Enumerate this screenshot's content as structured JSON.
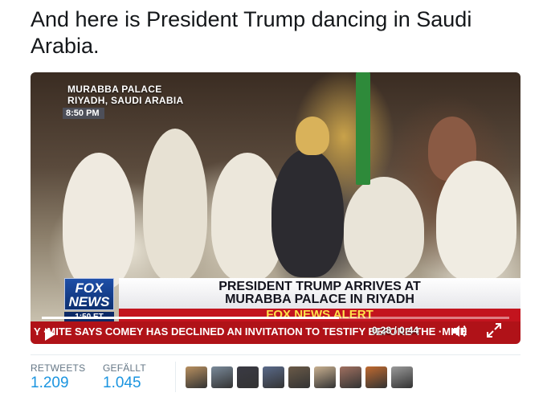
{
  "tweet": {
    "text": "And here is President Trump dancing in Saudi Arabia."
  },
  "video": {
    "location_line1": "MURABBA PALACE",
    "location_line2": "RIYADH, SAUDI ARABIA",
    "local_time": "8:50 PM",
    "logo_line1": "FOX",
    "logo_line2": "NEWS",
    "clock": "1:50 ET",
    "headline_line1": "PRESIDENT TRUMP ARRIVES AT",
    "headline_line2": "MURABBA PALACE IN RIYADH",
    "alert": "FOX NEWS ALERT",
    "ticker": "Y   ·MITE SAYS COMEY HAS DECLINED AN INVITATION TO TESTIFY BEFORE THE ·MITE",
    "elapsed_time": "0:28 / 0:44",
    "progress": 0.636
  },
  "stats": {
    "retweets_label": "RETWEETS",
    "retweets_value": "1.209",
    "likes_label": "GEFÄLLT",
    "likes_value": "1.045"
  },
  "avatars": [
    {
      "name": "avatar-1",
      "color": "#b89060"
    },
    {
      "name": "avatar-2",
      "color": "#7a8a9a"
    },
    {
      "name": "avatar-3",
      "color": "#3a3a44"
    },
    {
      "name": "avatar-4",
      "color": "#5a6a8a"
    },
    {
      "name": "avatar-5",
      "color": "#6a5a48"
    },
    {
      "name": "avatar-6",
      "color": "#c8b090"
    },
    {
      "name": "avatar-7",
      "color": "#a07060"
    },
    {
      "name": "avatar-8",
      "color": "#c06a30"
    },
    {
      "name": "avatar-9",
      "color": "#9a9a9a"
    }
  ]
}
